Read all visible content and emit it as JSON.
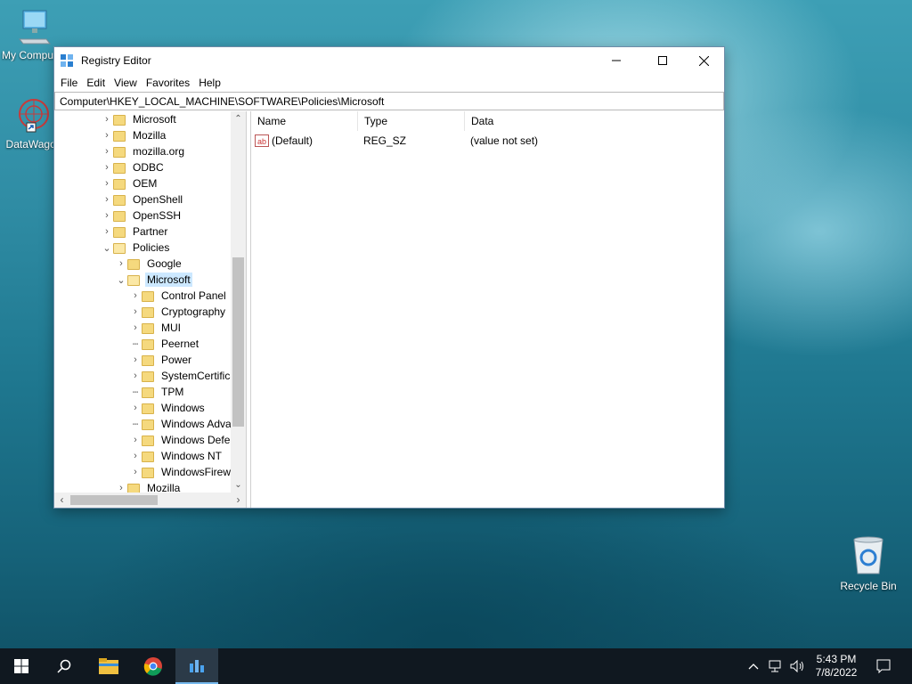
{
  "desktop": {
    "icons": [
      {
        "label": "My Computer"
      },
      {
        "label": "DataWagon"
      },
      {
        "label": "Recycle Bin"
      }
    ]
  },
  "window": {
    "title": "Registry Editor",
    "menu": [
      "File",
      "Edit",
      "View",
      "Favorites",
      "Help"
    ],
    "address": "Computer\\HKEY_LOCAL_MACHINE\\SOFTWARE\\Policies\\Microsoft",
    "tree": [
      {
        "label": "Microsoft"
      },
      {
        "label": "Mozilla"
      },
      {
        "label": "mozilla.org"
      },
      {
        "label": "ODBC"
      },
      {
        "label": "OEM"
      },
      {
        "label": "OpenShell"
      },
      {
        "label": "OpenSSH"
      },
      {
        "label": "Partner"
      },
      {
        "label": "Policies"
      },
      {
        "label": "Google"
      },
      {
        "label": "Microsoft"
      },
      {
        "label": "Control Panel"
      },
      {
        "label": "Cryptography"
      },
      {
        "label": "MUI"
      },
      {
        "label": "Peernet"
      },
      {
        "label": "Power"
      },
      {
        "label": "SystemCertificates"
      },
      {
        "label": "TPM"
      },
      {
        "label": "Windows"
      },
      {
        "label": "Windows Advanced Threat Protection"
      },
      {
        "label": "Windows Defender"
      },
      {
        "label": "Windows NT"
      },
      {
        "label": "WindowsFirewall"
      },
      {
        "label": "Mozilla"
      }
    ],
    "columns": {
      "name": "Name",
      "type": "Type",
      "data": "Data"
    },
    "values": [
      {
        "name": "(Default)",
        "type": "REG_SZ",
        "data": "(value not set)"
      }
    ]
  },
  "taskbar": {
    "time": "5:43 PM",
    "date": "7/8/2022"
  }
}
